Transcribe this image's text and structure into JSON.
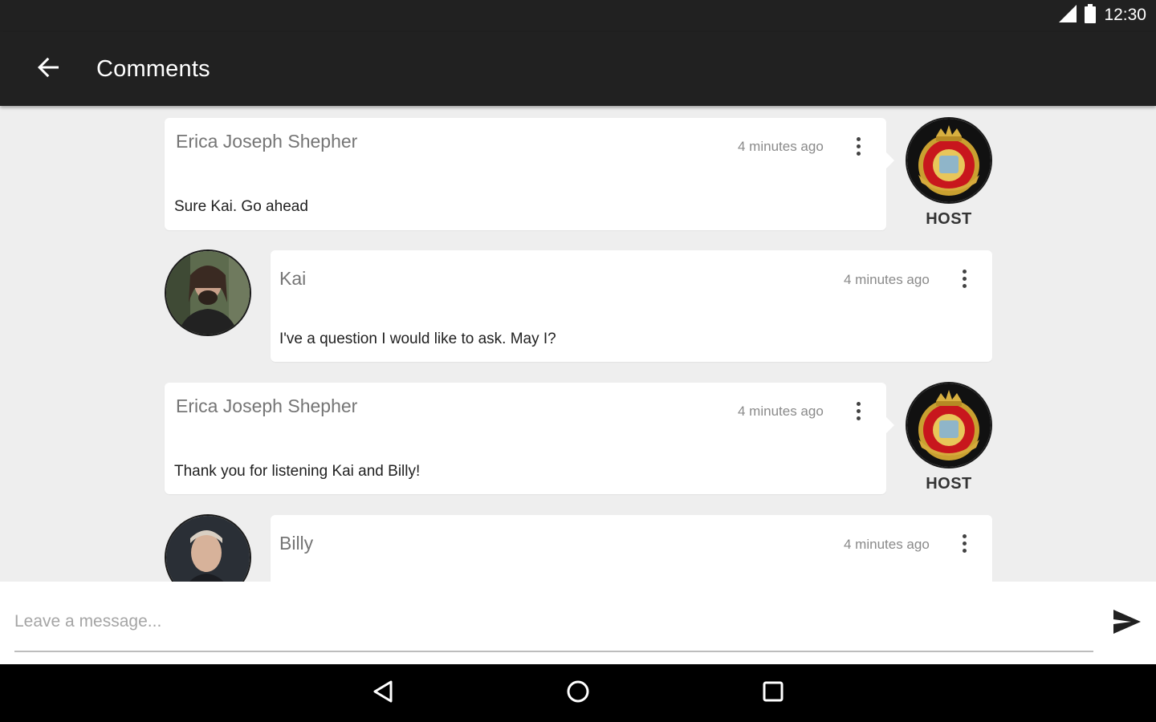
{
  "status_bar": {
    "time": "12:30",
    "icons": [
      "signal-icon",
      "battery-icon"
    ]
  },
  "app_bar": {
    "title": "Comments",
    "back_icon": "arrow-back-icon"
  },
  "comments": [
    {
      "author": "Erica Joseph Shepher",
      "time": "4 minutes ago",
      "text": "Sure Kai. Go ahead",
      "role": "HOST"
    },
    {
      "author": "Kai",
      "time": "4 minutes ago",
      "text": "I've a question I would like to ask. May I?"
    },
    {
      "author": "Erica Joseph Shepher",
      "time": "4 minutes ago",
      "text": "Thank you for listening Kai and Billy!",
      "role": "HOST"
    },
    {
      "author": "Billy",
      "time": "4 minutes ago",
      "text": ""
    }
  ],
  "composer": {
    "placeholder": "Leave a message...",
    "value": "",
    "send_icon": "send-icon"
  },
  "nav_bar": {
    "icons": [
      "nav-back-icon",
      "nav-home-icon",
      "nav-recents-icon"
    ]
  },
  "colors": {
    "toolbar": "#212121",
    "background": "#eeeeee",
    "bubble": "#ffffff",
    "nav": "#000000"
  }
}
